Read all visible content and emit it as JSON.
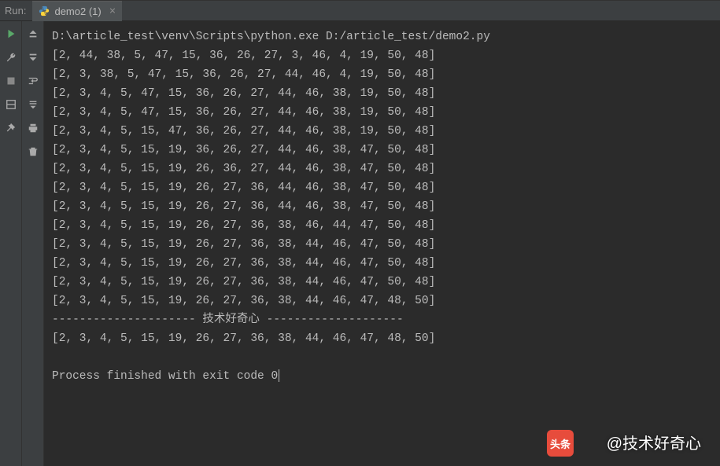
{
  "panel": {
    "label": "Run:"
  },
  "tab": {
    "name": "demo2 (1)"
  },
  "console": {
    "command": "D:\\article_test\\venv\\Scripts\\python.exe D:/article_test/demo2.py",
    "lines": [
      "[2, 44, 38, 5, 47, 15, 36, 26, 27, 3, 46, 4, 19, 50, 48]",
      "[2, 3, 38, 5, 47, 15, 36, 26, 27, 44, 46, 4, 19, 50, 48]",
      "[2, 3, 4, 5, 47, 15, 36, 26, 27, 44, 46, 38, 19, 50, 48]",
      "[2, 3, 4, 5, 47, 15, 36, 26, 27, 44, 46, 38, 19, 50, 48]",
      "[2, 3, 4, 5, 15, 47, 36, 26, 27, 44, 46, 38, 19, 50, 48]",
      "[2, 3, 4, 5, 15, 19, 36, 26, 27, 44, 46, 38, 47, 50, 48]",
      "[2, 3, 4, 5, 15, 19, 26, 36, 27, 44, 46, 38, 47, 50, 48]",
      "[2, 3, 4, 5, 15, 19, 26, 27, 36, 44, 46, 38, 47, 50, 48]",
      "[2, 3, 4, 5, 15, 19, 26, 27, 36, 44, 46, 38, 47, 50, 48]",
      "[2, 3, 4, 5, 15, 19, 26, 27, 36, 38, 46, 44, 47, 50, 48]",
      "[2, 3, 4, 5, 15, 19, 26, 27, 36, 38, 44, 46, 47, 50, 48]",
      "[2, 3, 4, 5, 15, 19, 26, 27, 36, 38, 44, 46, 47, 50, 48]",
      "[2, 3, 4, 5, 15, 19, 26, 27, 36, 38, 44, 46, 47, 50, 48]",
      "[2, 3, 4, 5, 15, 19, 26, 27, 36, 38, 44, 46, 47, 48, 50]"
    ],
    "separator": "--------------------- 技术好奇心 --------------------",
    "result": "[2, 3, 4, 5, 15, 19, 26, 27, 36, 38, 44, 46, 47, 48, 50]",
    "exit_message": "Process finished with exit code 0"
  },
  "watermark": {
    "logo": "头条",
    "text": "@技术好奇心"
  }
}
